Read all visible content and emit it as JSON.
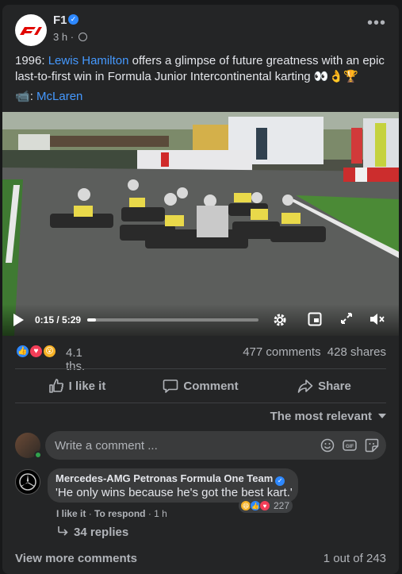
{
  "post": {
    "page_name": "F1",
    "verified_icon": "verified-badge-icon",
    "time": "3 h",
    "separator": "·",
    "privacy_icon": "globe-icon",
    "more_label": "•••",
    "text_prefix": "1996: ",
    "text_link": "Lewis Hamilton",
    "text_body": " offers a glimpse of future greatness with an epic last-to-first win in Formula Junior Intercontinental karting 👀👌🏆",
    "credit_icon": "📹",
    "credit_sep": ": ",
    "credit_link": "McLaren",
    "logo_text": "F1"
  },
  "video": {
    "current_time": "0:15",
    "duration": "5:29",
    "time_display": "0:15 / 5:29",
    "progress_fraction": 0.05,
    "controls": [
      "play-icon",
      "settings-icon",
      "pip-icon",
      "fullscreen-icon",
      "mute-icon"
    ]
  },
  "stats": {
    "reactions": [
      "like-icon",
      "love-icon",
      "wow-icon"
    ],
    "reaction_count": "4.1 ths.",
    "comments": "477 comments",
    "shares": "428 shares"
  },
  "actions": {
    "like": "I like it",
    "comment": "Comment",
    "share": "Share"
  },
  "comments": {
    "sort_label": "The most relevant",
    "input_placeholder": "Write a comment ...",
    "input_icons": [
      "emoji-icon",
      "gif-icon",
      "sticker-icon"
    ],
    "items": [
      {
        "author": "Mercedes-AMG Petronas Formula One Team",
        "text": "'He only wins because he's got the best kart.'",
        "like_link": "I like it",
        "sep": " · ",
        "respond_link": "To respond",
        "time": "1 h",
        "reaction_count": "227",
        "reactions": [
          "haha-icon",
          "like-icon",
          "love-icon"
        ],
        "replies": "34 replies"
      }
    ],
    "view_more": "View more comments",
    "pagination": "1 out of 243"
  },
  "colors": {
    "background": "#18191a",
    "card": "#242526",
    "link": "#4599ff",
    "secondary_text": "#b0b3b8",
    "primary_text": "#e4e6eb",
    "verified": "#2d88ff"
  }
}
